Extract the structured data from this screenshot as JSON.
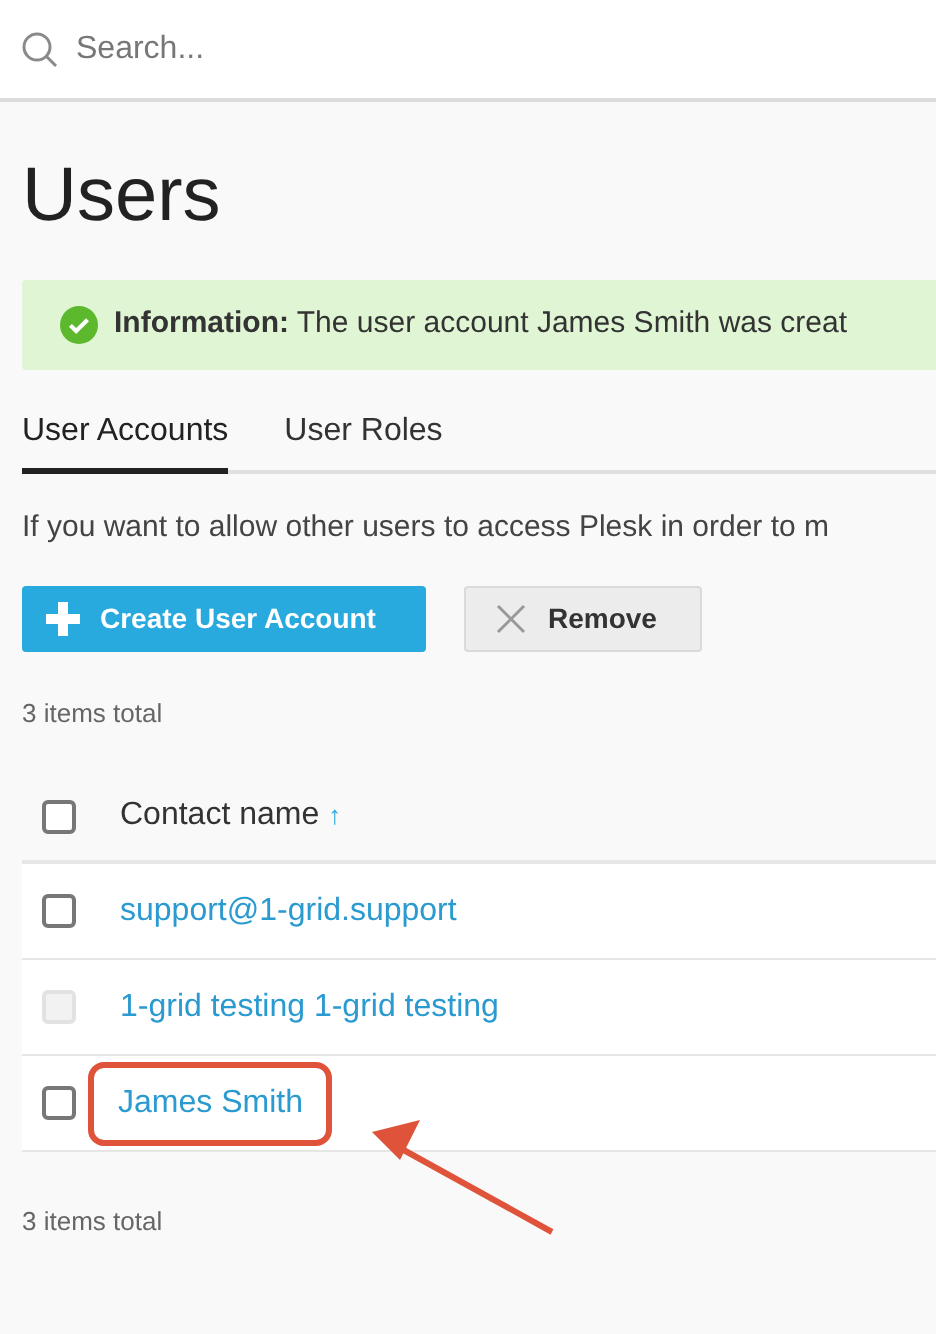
{
  "search": {
    "placeholder": "Search..."
  },
  "title": "Users",
  "message": {
    "kind": "success",
    "text": "**Information:** The user account James Smith was creat"
  },
  "tabs": [
    {
      "label": "User Accounts",
      "selected": true
    },
    {
      "label": "User Roles",
      "selected": false
    }
  ],
  "description": "If you want to allow other users to access Plesk in order to m",
  "buttons": [
    {
      "kind": "primary",
      "label": "Create User Account"
    },
    {
      "kind": "remove",
      "label": "Remove"
    }
  ],
  "total_top": "3 items total",
  "table": {
    "column": "Contact name",
    "sort": "↑",
    "all_checked": false,
    "rows": [
      {
        "name": "support@1-grid.support",
        "checked": false,
        "disabled": false,
        "highlighted": false
      },
      {
        "name": "1-grid testing 1-grid testing",
        "checked": false,
        "disabled": true,
        "highlighted": false
      },
      {
        "name": "James Smith",
        "checked": false,
        "disabled": false,
        "highlighted": true
      }
    ]
  },
  "total_bottom": "3 items total"
}
